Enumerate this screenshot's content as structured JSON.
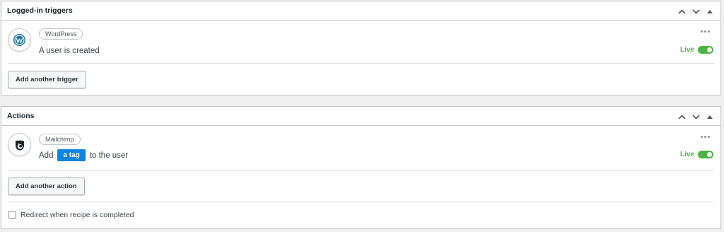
{
  "triggers_panel": {
    "title": "Logged-in triggers",
    "items": [
      {
        "integration": "WordPress",
        "logo_icon": "wordpress-logo-icon",
        "sentence": "A user is created",
        "status_label": "Live",
        "status_color": "#4bb543"
      }
    ],
    "add_button_label": "Add another trigger"
  },
  "actions_panel": {
    "title": "Actions",
    "items": [
      {
        "integration": "Mailchimp",
        "logo_icon": "mailchimp-logo-icon",
        "sentence_before": "Add",
        "token_label": "a tag",
        "sentence_after": "to the user",
        "status_label": "Live",
        "status_color": "#4bb543"
      }
    ],
    "add_button_label": "Add another action",
    "redirect_checkbox_label": "Redirect when recipe is completed",
    "redirect_checked": false
  },
  "colors": {
    "live_green": "#4bb543",
    "token_blue": "#0e85e1",
    "wordpress_blue": "#21759b"
  }
}
